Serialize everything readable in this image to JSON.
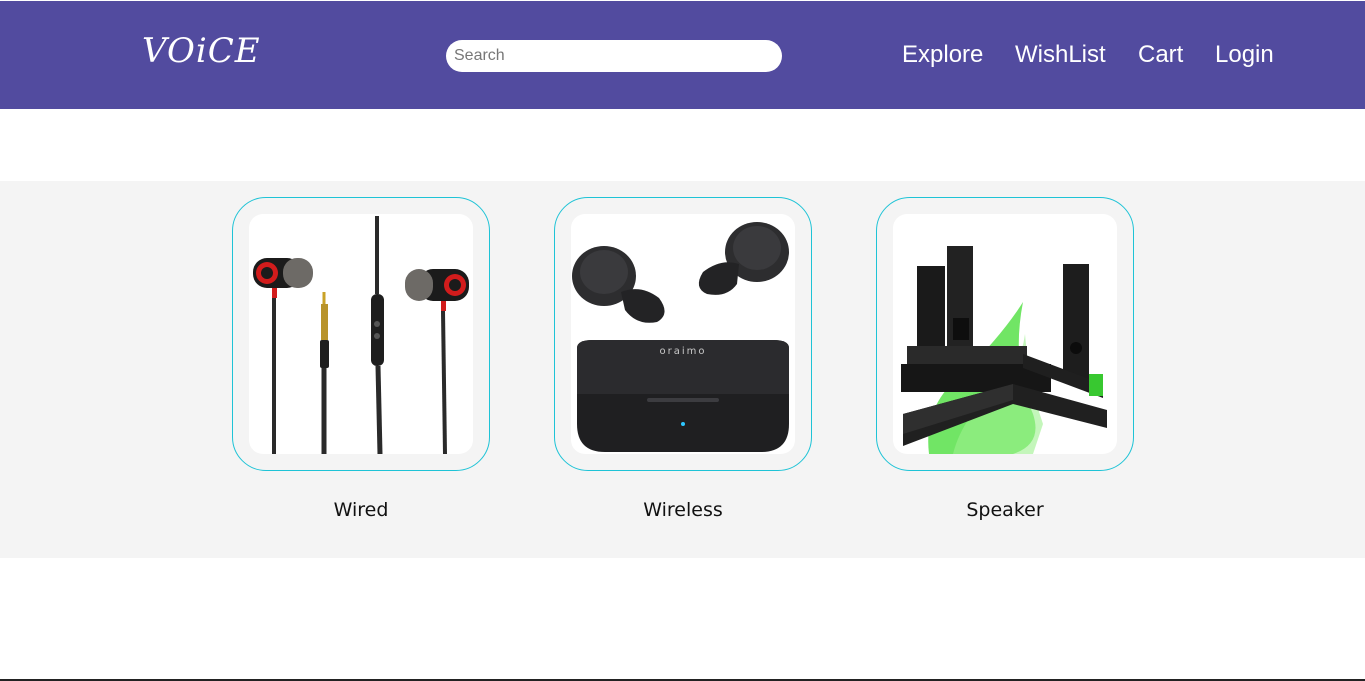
{
  "header": {
    "logo": "VOiCE",
    "search_placeholder": "Search",
    "nav": [
      "Explore",
      "WishList",
      "Cart",
      "Login"
    ]
  },
  "categories": [
    {
      "label": "Wired",
      "image": "wired-earphones"
    },
    {
      "label": "Wireless",
      "image": "wireless-earbuds"
    },
    {
      "label": "Speaker",
      "image": "soundbar-speakers"
    }
  ],
  "colors": {
    "header_bg": "#524b9f",
    "card_border": "#1ec3d6",
    "band_bg": "#f4f4f4"
  }
}
